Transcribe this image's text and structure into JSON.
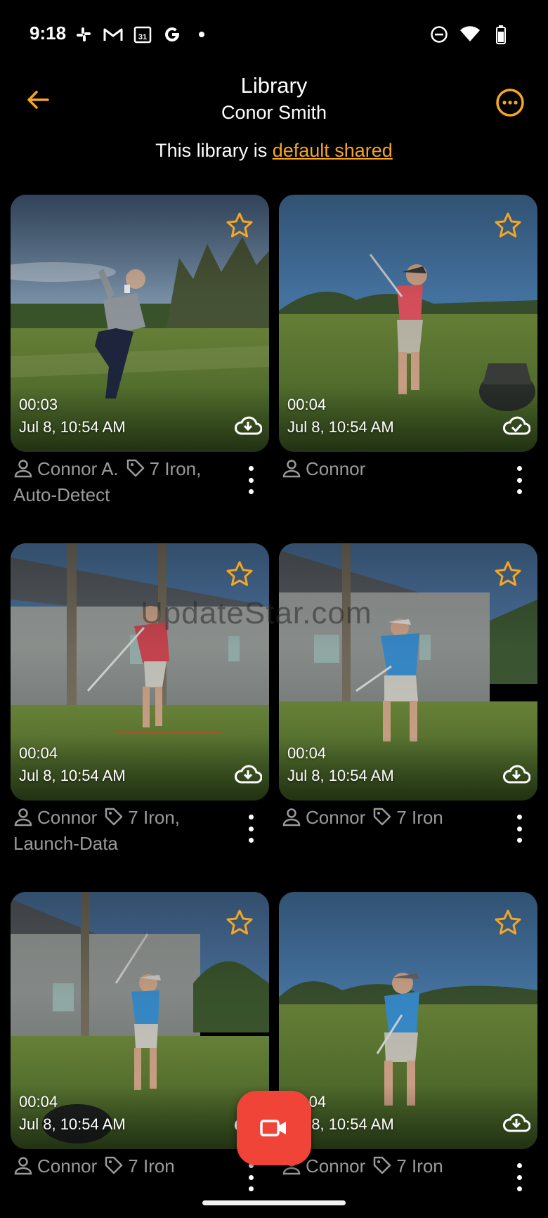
{
  "status_bar": {
    "time": "9:18",
    "left_icons": [
      "slack-icon",
      "gmail-icon",
      "calendar-icon",
      "google-icon",
      "dot-icon"
    ],
    "calendar_day": "31",
    "right_icons": [
      "do-not-disturb-icon",
      "wifi-icon",
      "battery-icon"
    ]
  },
  "header": {
    "title": "Library",
    "subtitle": "Conor Smith",
    "share_prefix": "This library is ",
    "share_link": "default shared"
  },
  "watermark": "UpdateStar.com",
  "colors": {
    "accent": "#f5a623",
    "fab": "#f04438",
    "meta_text": "#9a9a9a"
  },
  "videos": [
    {
      "duration": "00:03",
      "date": "Jul 8, 10:54 AM",
      "person": "Connor A.",
      "tags": "7 Iron,",
      "tags_line2": "Auto-Detect",
      "cloud": "cloud-download-icon"
    },
    {
      "duration": "00:04",
      "date": "Jul 8, 10:54 AM",
      "person": "Connor",
      "tags": "",
      "tags_line2": "",
      "cloud": "cloud-done-icon"
    },
    {
      "duration": "00:04",
      "date": "Jul 8, 10:54 AM",
      "person": "Connor",
      "tags": "7 Iron,",
      "tags_line2": "Launch-Data",
      "cloud": "cloud-download-icon"
    },
    {
      "duration": "00:04",
      "date": "Jul 8, 10:54 AM",
      "person": "Connor",
      "tags": "7 Iron",
      "tags_line2": "",
      "cloud": "cloud-download-icon"
    },
    {
      "duration": "00:04",
      "date": "Jul 8, 10:54 AM",
      "person": "Connor",
      "tags": "7 Iron",
      "tags_line2": "",
      "cloud": "cloud-download-icon"
    },
    {
      "duration": "00:04",
      "date": "Jul 8, 10:54 AM",
      "person": "Connor",
      "tags": "7 Iron",
      "tags_line2": "",
      "cloud": "cloud-download-icon"
    }
  ],
  "fab": {
    "icon": "video-camera-icon"
  }
}
